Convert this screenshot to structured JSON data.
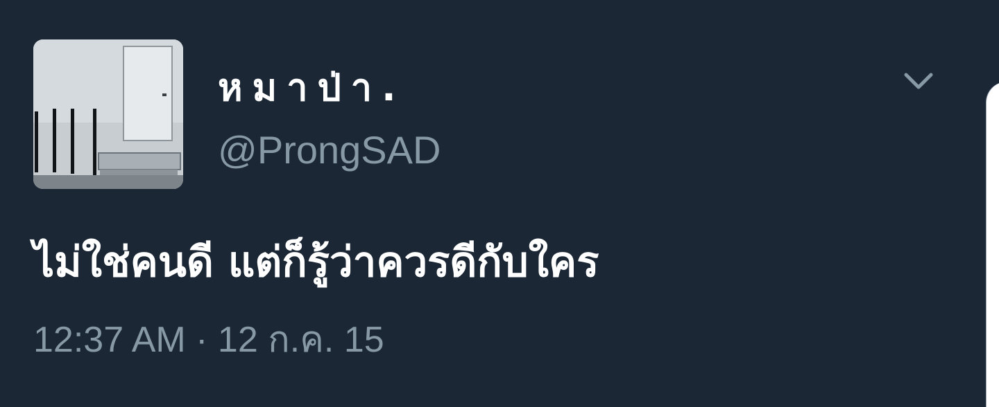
{
  "tweet": {
    "display_name": "หมาป่า.",
    "handle": "@ProngSAD",
    "text": "ไม่ใช่คนดี แต่ก็รู้ว่าควรดีกับใคร",
    "timestamp": "12:37 AM · 12 ก.ค. 15"
  },
  "icons": {
    "menu": "chevron-down-icon"
  },
  "colors": {
    "background": "#1b2735",
    "primary_text": "#ffffff",
    "secondary_text": "#8899a6"
  }
}
